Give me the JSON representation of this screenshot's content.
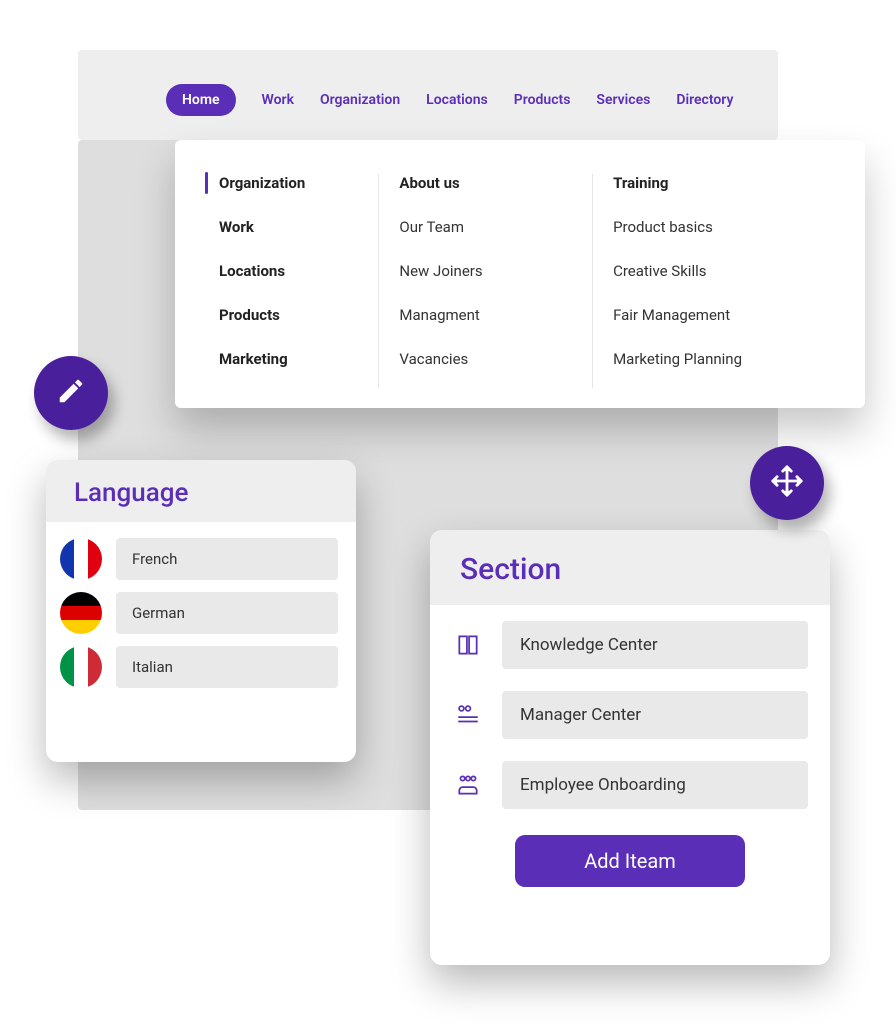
{
  "nav": {
    "tabs": [
      "Home",
      "Work",
      "Organization",
      "Locations",
      "Products",
      "Services",
      "Directory"
    ],
    "active": "Home"
  },
  "megamenu": {
    "col1": [
      "Organization",
      "Work",
      "Locations",
      "Products",
      "Marketing"
    ],
    "col1_selected": "Organization",
    "col2": {
      "head": "About us",
      "items": [
        "Our Team",
        "New Joiners",
        "Managment",
        "Vacancies"
      ]
    },
    "col3": {
      "head": "Training",
      "items": [
        "Product basics",
        "Creative Skills",
        "Fair Management",
        "Marketing Planning"
      ]
    }
  },
  "language": {
    "title": "Language",
    "items": [
      {
        "label": "French",
        "flag": "fr"
      },
      {
        "label": "German",
        "flag": "de"
      },
      {
        "label": "Italian",
        "flag": "it"
      }
    ]
  },
  "section": {
    "title": "Section",
    "items": [
      "Knowledge Center",
      "Manager Center",
      "Employee Onboarding"
    ],
    "button": "Add Iteam"
  }
}
